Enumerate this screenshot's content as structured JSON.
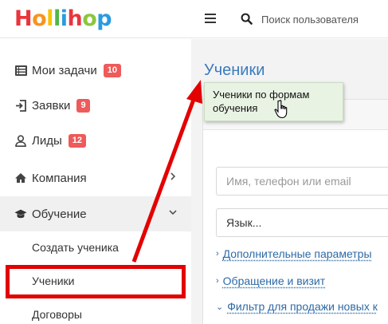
{
  "app": {
    "logo_letters": [
      "H",
      "o",
      "l",
      "l",
      "i",
      "h",
      "o",
      "p"
    ],
    "logo_colors": [
      "#e8353b",
      "#f7941d",
      "#f6c400",
      "#4db848",
      "#2a9be0",
      "#e8353b",
      "#8cc63f",
      "#2a9be0"
    ]
  },
  "topbar": {
    "menu_icon": "hamburger-icon",
    "search_icon": "search-icon",
    "search_placeholder": "Поиск пользователя"
  },
  "sidebar": {
    "items": [
      {
        "label": "Мои задачи",
        "icon": "list-icon",
        "badge": "10"
      },
      {
        "label": "Заявки",
        "icon": "sign-in-icon",
        "badge": "9"
      },
      {
        "label": "Лиды",
        "icon": "user-icon",
        "badge": "12"
      },
      {
        "label": "Компания",
        "icon": "home-icon",
        "chevron": "chevron-right-icon"
      },
      {
        "label": "Обучение",
        "icon": "graduation-cap-icon",
        "chevron": "chevron-down-icon"
      }
    ],
    "subitems": [
      {
        "label": "Создать ученика"
      },
      {
        "label": "Ученики"
      },
      {
        "label": "Договоры"
      }
    ]
  },
  "main": {
    "title": "Ученики",
    "search_placeholder": "Имя, телефон или email",
    "language_select": "Язык...",
    "links": [
      {
        "label": "Дополнительные параметры",
        "arrow": "›"
      },
      {
        "label": "Обращение и визит",
        "arrow": "›"
      },
      {
        "label": "Фильтр для продажи новых к",
        "arrow": "⌄"
      }
    ]
  },
  "tooltip": {
    "text": "Ученики по формам обучения"
  },
  "colors": {
    "accent_blue": "#3a7bbf",
    "badge_red": "#ef5a5a",
    "annotation_red": "#e30000",
    "tooltip_bg": "#e9f3e4"
  }
}
